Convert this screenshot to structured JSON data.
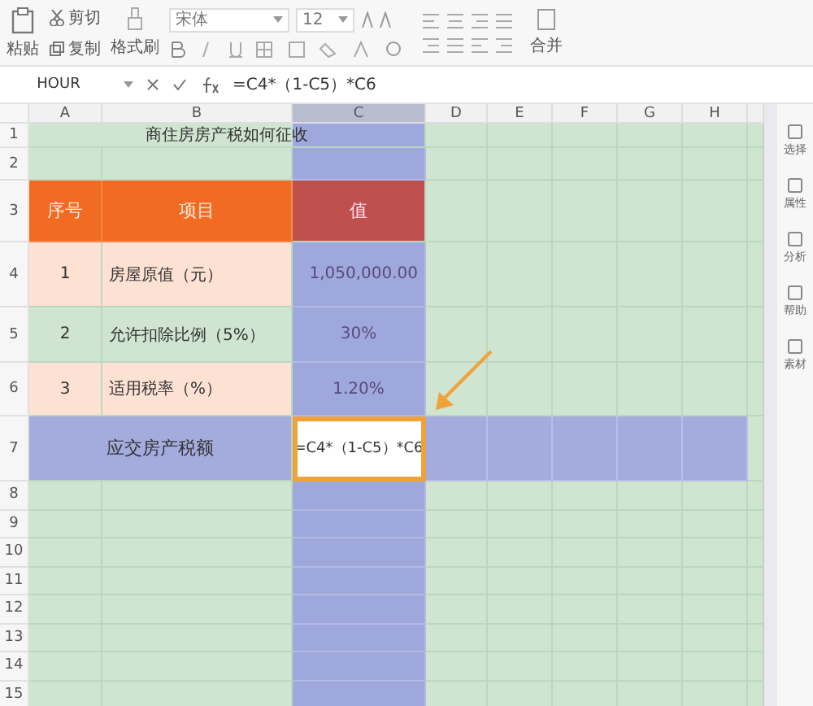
{
  "toolbar": {
    "paste": "粘贴",
    "cut": "剪切",
    "copy": "复制",
    "format_painter": "格式刷",
    "font": "宋体",
    "size": "12",
    "merge": "合并"
  },
  "formula_bar": {
    "name_box": "HOUR",
    "formula": "=C4*（1-C5）*C6"
  },
  "columns": [
    {
      "label": "A",
      "selected": false
    },
    {
      "label": "B",
      "selected": false
    },
    {
      "label": "C",
      "selected": true
    },
    {
      "label": "D",
      "selected": false
    },
    {
      "label": "E",
      "selected": false
    },
    {
      "label": "F",
      "selected": false
    },
    {
      "label": "G",
      "selected": false
    },
    {
      "label": "H",
      "selected": false
    }
  ],
  "rows": [
    {
      "label": "1",
      "kind": "title",
      "cells": [
        {
          "text": "商住房房产税如何征收",
          "selected": false
        }
      ]
    },
    {
      "label": "2",
      "kind": "blank"
    },
    {
      "label": "3",
      "kind": "header",
      "cells": [
        {
          "text": "序号",
          "selected": false
        },
        {
          "text": "项目",
          "selected": false
        },
        {
          "text": "值",
          "selected": false
        }
      ]
    },
    {
      "label": "4",
      "kind": "peach",
      "cells": [
        {
          "text": "1",
          "selected": false
        },
        {
          "text": "房屋原值（元）",
          "selected": false
        },
        {
          "text": "1,050,000.00",
          "selected": false
        }
      ]
    },
    {
      "label": "5",
      "kind": "green",
      "cells": [
        {
          "text": "2",
          "selected": false
        },
        {
          "text": "允许扣除比例（5%）",
          "selected": false
        },
        {
          "text": "30%",
          "selected": false
        }
      ]
    },
    {
      "label": "6",
      "kind": "peach",
      "cells": [
        {
          "text": "3",
          "selected": false
        },
        {
          "text": "适用税率（%）",
          "selected": false
        },
        {
          "text": "1.20%",
          "selected": false
        }
      ]
    },
    {
      "label": "7",
      "kind": "total",
      "cells": [
        {
          "text": "应交房产税额",
          "selected": false
        },
        {
          "text": "=C4*（1-C5）*C6",
          "selected": true
        }
      ]
    },
    {
      "label": "8",
      "kind": "blank"
    },
    {
      "label": "9",
      "kind": "blank"
    },
    {
      "label": "10",
      "kind": "blank"
    },
    {
      "label": "11",
      "kind": "blank"
    },
    {
      "label": "12",
      "kind": "blank"
    },
    {
      "label": "13",
      "kind": "blank"
    },
    {
      "label": "14",
      "kind": "blank"
    },
    {
      "label": "15",
      "kind": "blank"
    }
  ],
  "side_panel": [
    "选择",
    "属性",
    "分析",
    "帮助",
    "素材"
  ]
}
